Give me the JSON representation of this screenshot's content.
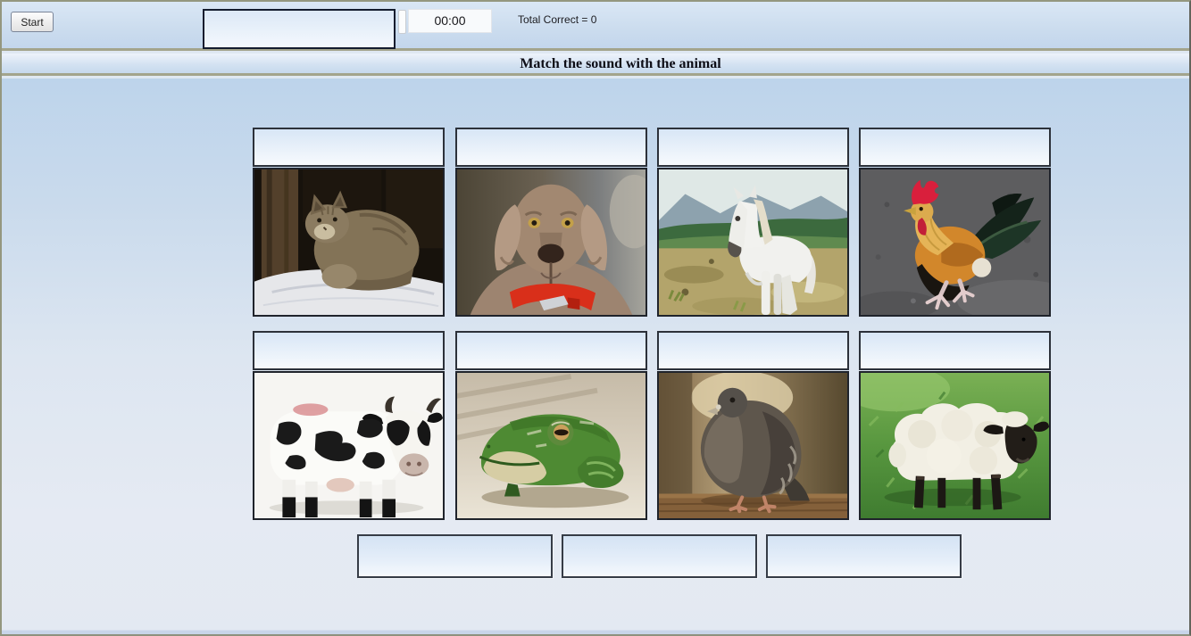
{
  "header": {
    "title": "Match the sound with the animal"
  },
  "toolbar": {
    "start_button": "Start",
    "sound_word": "",
    "timer": "00:00",
    "score": "Total Correct = 0"
  },
  "board": {
    "animals": [
      {
        "name": "cat",
        "drop_slot_value": ""
      },
      {
        "name": "dog",
        "drop_slot_value": ""
      },
      {
        "name": "horse",
        "drop_slot_value": ""
      },
      {
        "name": "rooster",
        "drop_slot_value": ""
      },
      {
        "name": "cow",
        "drop_slot_value": ""
      },
      {
        "name": "frog",
        "drop_slot_value": ""
      },
      {
        "name": "pigeon",
        "drop_slot_value": ""
      },
      {
        "name": "sheep",
        "drop_slot_value": ""
      }
    ],
    "word_bank_slots": [
      "",
      "",
      ""
    ]
  },
  "colors": {
    "divider": "#a3a48c",
    "slot_border": "#2c313a",
    "panel_top": "#bdd4eb",
    "panel_bottom": "#e3e9f2",
    "collar_red": "#d92f1a",
    "comb_red": "#d91f3c"
  }
}
